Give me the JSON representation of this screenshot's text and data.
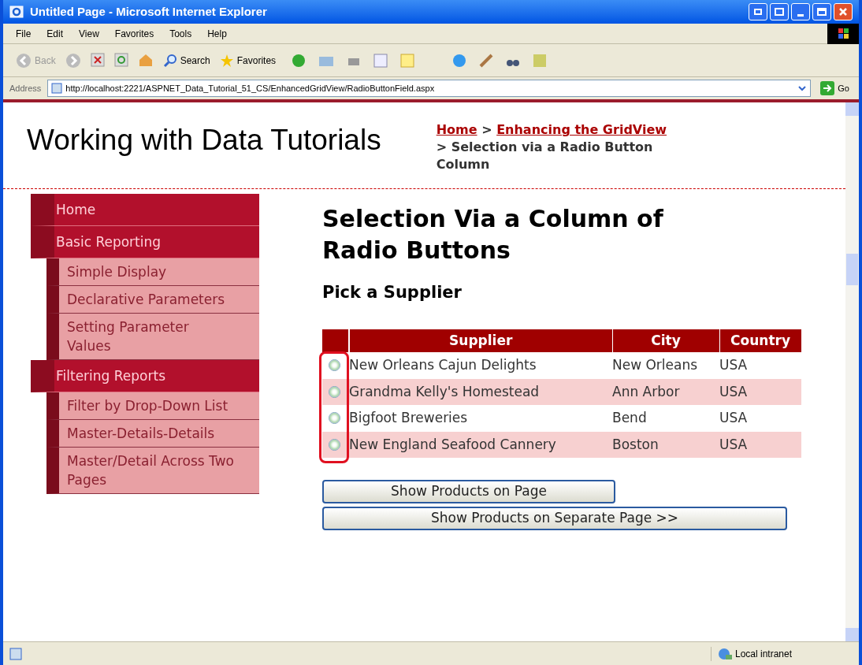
{
  "window": {
    "title": "Untitled Page - Microsoft Internet Explorer"
  },
  "menu": [
    "File",
    "Edit",
    "View",
    "Favorites",
    "Tools",
    "Help"
  ],
  "toolbar": [
    {
      "kind": "back",
      "label": "Back"
    },
    {
      "kind": "search",
      "label": "Search"
    },
    {
      "kind": "favorites",
      "label": "Favorites"
    }
  ],
  "address": {
    "label": "Address",
    "value": "http://localhost:2221/ASPNET_Data_Tutorial_51_CS/EnhancedGridView/RadioButtonField.aspx",
    "go": "Go"
  },
  "page": {
    "site_title": "Working with Data Tutorials",
    "breadcrumb": [
      {
        "kind": "link",
        "text": "Home"
      },
      {
        "kind": "sep",
        "text": ">"
      },
      {
        "kind": "link",
        "text": "Enhancing the GridView"
      },
      {
        "kind": "sep",
        "text": ">"
      },
      {
        "kind": "current",
        "text": "Selection via a Radio Button Column"
      }
    ],
    "sidebar": [
      {
        "label": "Home"
      },
      {
        "label": "Basic Reporting",
        "children": [
          {
            "label": "Simple Display"
          },
          {
            "label": "Declarative Parameters"
          },
          {
            "label": "Setting Parameter Values"
          }
        ]
      },
      {
        "label": "Filtering Reports",
        "children": [
          {
            "label": "Filter by Drop-Down List"
          },
          {
            "label": "Master-Details-Details"
          },
          {
            "label": "Master/Detail Across Two Pages"
          }
        ]
      }
    ],
    "heading": "Selection Via a Column of Radio Buttons",
    "subheading": "Pick a Supplier",
    "table": {
      "columns": [
        "Supplier",
        "City",
        "Country"
      ],
      "rows": [
        {
          "selected": false,
          "cells": [
            "New Orleans Cajun Delights",
            "New Orleans",
            "USA"
          ]
        },
        {
          "selected": false,
          "cells": [
            "Grandma Kelly's Homestead",
            "Ann Arbor",
            "USA"
          ]
        },
        {
          "selected": false,
          "cells": [
            "Bigfoot Breweries",
            "Bend",
            "USA"
          ]
        },
        {
          "selected": false,
          "cells": [
            "New England Seafood Cannery",
            "Boston",
            "USA"
          ]
        }
      ]
    },
    "buttons": [
      "Show Products on Page",
      "Show Products on Separate Page >>"
    ]
  },
  "status_bar": {
    "zone": "Local intranet"
  }
}
